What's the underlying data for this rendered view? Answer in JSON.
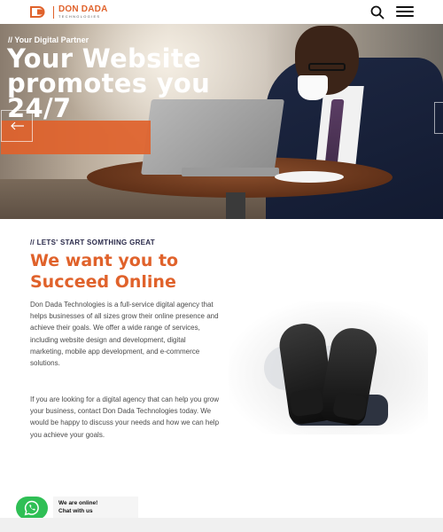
{
  "header": {
    "logo_name": "DON DADA",
    "logo_sub": "TECHNOLOGIES",
    "search_icon": "search-icon",
    "menu_icon": "hamburger-menu-icon"
  },
  "hero": {
    "tagline": "// Your Digital Partner",
    "title": "Your Website promotes you 24/7",
    "prev_icon": "arrow-left-icon"
  },
  "intro": {
    "tag": "// LETS' START SOMTHING GREAT",
    "title": "We want you to Succeed Online",
    "paragraph1": "Don Dada Technologies is a full-service digital agency that helps businesses of all sizes grow their online presence and achieve their goals. We offer a wide range of services, including website design and development, digital marketing, mobile app development, and e-commerce solutions.",
    "paragraph2": "If you are looking for a digital agency that can help you grow your business, contact Don Dada Technologies today. We would be happy to discuss your needs and how we can help you achieve your goals."
  },
  "chat": {
    "line1": "We are online!",
    "line2": "Chat with us",
    "icon": "whatsapp-icon"
  },
  "colors": {
    "accent": "#e0622b",
    "dark_heading": "#2a2a4a",
    "whatsapp": "#2fbf55"
  }
}
